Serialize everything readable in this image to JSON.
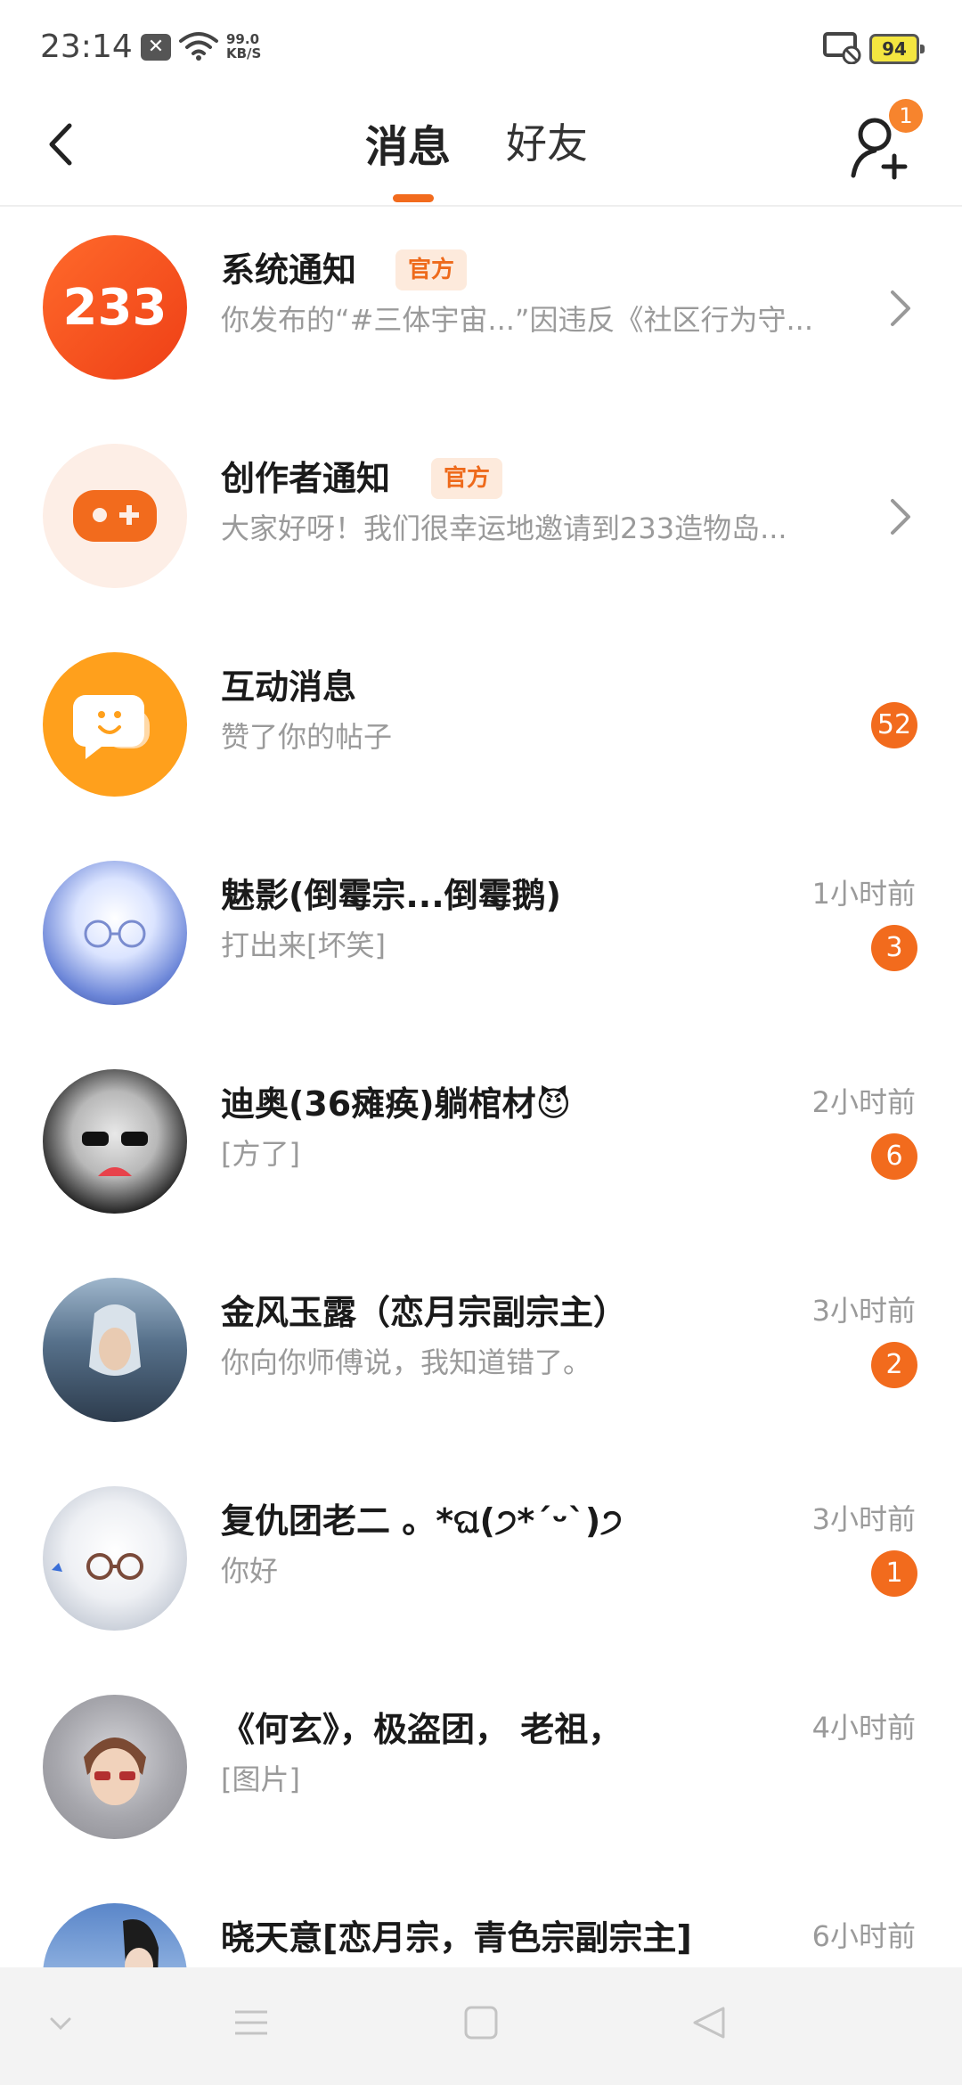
{
  "status_bar": {
    "time": "23:14",
    "notification_icon": "x-box-icon",
    "net_speed_value": "99.0",
    "net_speed_unit": "KB/S",
    "battery": "94"
  },
  "header": {
    "tabs": [
      {
        "label": "消息",
        "active": true
      },
      {
        "label": "好友",
        "active": false
      }
    ],
    "add_friend_badge": "1"
  },
  "conversations": [
    {
      "title": "系统通知",
      "badge": "官方",
      "subtitle": "你发布的“#三体宇宙...”因违反《社区行为守...",
      "type": "official",
      "icon": "233-logo-icon"
    },
    {
      "title": "创作者通知",
      "badge": "官方",
      "subtitle": "大家好呀！我们很幸运地邀请到233造物岛...",
      "type": "official",
      "icon": "gamepad-icon"
    },
    {
      "title": "互动消息",
      "subtitle": "赞了你的帖子",
      "count": "52",
      "type": "system",
      "icon": "chat-bubble-icon"
    },
    {
      "title": "魅影(倒霉宗...倒霉鹅)",
      "subtitle": "打出来[坏笑]",
      "time": "1小时前",
      "count": "3"
    },
    {
      "title": "迪奥(36瘫痪)躺棺材😈",
      "subtitle": "[方了]",
      "time": "2小时前",
      "count": "6"
    },
    {
      "title": "金风玉露（恋月宗副宗主）",
      "subtitle": "你向你师傅说，我知道错了。",
      "time": "3小时前",
      "count": "2"
    },
    {
      "title": "复仇团老二 。*ଘ(੭*ˊᵕˋ)੭",
      "subtitle": "你好",
      "time": "3小时前",
      "count": "1"
    },
    {
      "title": "《何玄》，极盗团， 老祖，",
      "subtitle": "[图片]",
      "time": "4小时前"
    },
    {
      "title": "晓天意[恋月宗，青色宗副宗主]",
      "subtitle": "",
      "time": "6小时前"
    }
  ],
  "colors": {
    "accent": "#f26b1d",
    "badge_bg": "#fdeadc",
    "muted_text": "#9a9a9a"
  },
  "nav_bar": {
    "buttons": [
      "chevron-down-icon",
      "menu-icon",
      "home-square-icon",
      "back-triangle-icon"
    ]
  }
}
